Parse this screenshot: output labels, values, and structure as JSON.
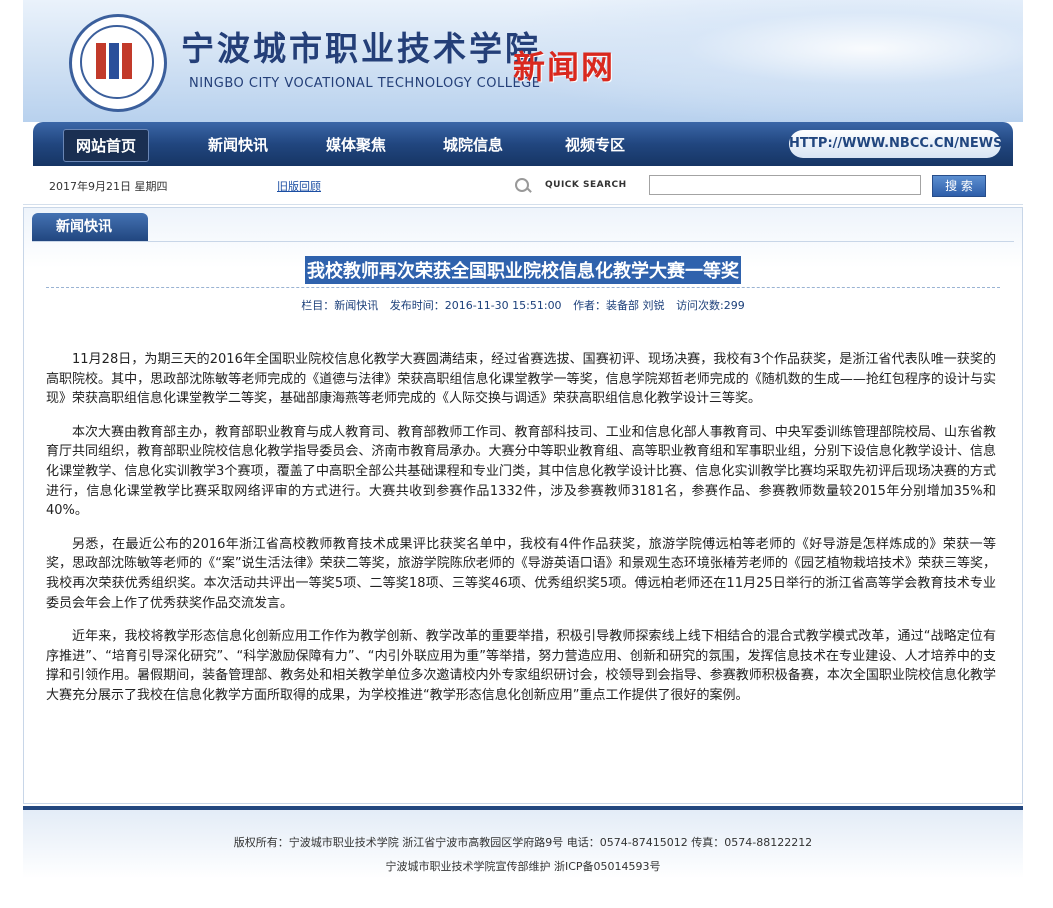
{
  "header": {
    "school_name_cn": "宁波城市职业技术学院",
    "school_name_en": "NINGBO CITY VOCATIONAL TECHNOLOGY COLLEGE",
    "site_name": "新闻网"
  },
  "nav": {
    "items": [
      {
        "label": "网站首页"
      },
      {
        "label": "新闻快讯"
      },
      {
        "label": "媒体聚焦"
      },
      {
        "label": "城院信息"
      },
      {
        "label": "视频专区"
      }
    ],
    "url_badge": "HTTP://WWW.NBCC.CN/NEWS"
  },
  "toolbar": {
    "date": "2017年9月21日 星期四",
    "old_version_link": "旧版回顾",
    "quick_search_label": "QUICK SEARCH",
    "search_value": "",
    "search_button": "搜 索"
  },
  "panel": {
    "tab_label": "新闻快讯",
    "title": "我校教师再次荣获全国职业院校信息化教学大赛一等奖",
    "meta": {
      "column": "栏目：新闻快讯",
      "published": "发布时间：2016-11-30 15:51:00",
      "author": "作者：装备部 刘锐",
      "views": "访问次数:299"
    },
    "paragraphs": [
      "11月28日，为期三天的2016年全国职业院校信息化教学大赛圆满结束，经过省赛选拔、国赛初评、现场决赛，我校有3个作品获奖，是浙江省代表队唯一获奖的高职院校。其中，思政部沈陈敏等老师完成的《道德与法律》荣获高职组信息化课堂教学一等奖，信息学院郑哲老师完成的《随机数的生成——抢红包程序的设计与实现》荣获高职组信息化课堂教学二等奖，基础部康海燕等老师完成的《人际交换与调适》荣获高职组信息化教学设计三等奖。",
      "本次大赛由教育部主办，教育部职业教育与成人教育司、教育部教师工作司、教育部科技司、工业和信息化部人事教育司、中央军委训练管理部院校局、山东省教育厅共同组织，教育部职业院校信息化教学指导委员会、济南市教育局承办。大赛分中等职业教育组、高等职业教育组和军事职业组，分别下设信息化教学设计、信息化课堂教学、信息化实训教学3个赛项，覆盖了中高职全部公共基础课程和专业门类，其中信息化教学设计比赛、信息化实训教学比赛均采取先初评后现场决赛的方式进行，信息化课堂教学比赛采取网络评审的方式进行。大赛共收到参赛作品1332件，涉及参赛教师3181名，参赛作品、参赛教师数量较2015年分别增加35%和40%。",
      "另悉，在最近公布的2016年浙江省高校教师教育技术成果评比获奖名单中，我校有4件作品获奖，旅游学院傅远柏等老师的《好导游是怎样炼成的》荣获一等奖，思政部沈陈敏等老师的《“案”说生活法律》荣获二等奖，旅游学院陈欣老师的《导游英语口语》和景观生态环境张椿芳老师的《园艺植物栽培技术》荣获三等奖，我校再次荣获优秀组织奖。本次活动共评出一等奖5项、二等奖18项、三等奖46项、优秀组织奖5项。傅远柏老师还在11月25日举行的浙江省高等学会教育技术专业委员会年会上作了优秀获奖作品交流发言。",
      "近年来，我校将教学形态信息化创新应用工作作为教学创新、教学改革的重要举措，积极引导教师探索线上线下相结合的混合式教学模式改革，通过“战略定位有序推进”、“培育引导深化研究”、“科学激励保障有力”、“内引外联应用为重”等举措，努力营造应用、创新和研究的氛围，发挥信息技术在专业建设、人才培养中的支撑和引领作用。暑假期间，装备管理部、教务处和相关教学单位多次邀请校内外专家组织研讨会，校领导到会指导、参赛教师积极备赛，本次全国职业院校信息化教学大赛充分展示了我校在信息化教学方面所取得的成果，为学校推进“教学形态信息化创新应用”重点工作提供了很好的案例。"
    ]
  },
  "footer": {
    "line1": "版权所有：宁波城市职业技术学院 浙江省宁波市高教园区学府路9号 电话：0574-87415012 传真：0574-88122212",
    "line2": "宁波城市职业技术学院宣传部维护 浙ICP备05014593号"
  }
}
